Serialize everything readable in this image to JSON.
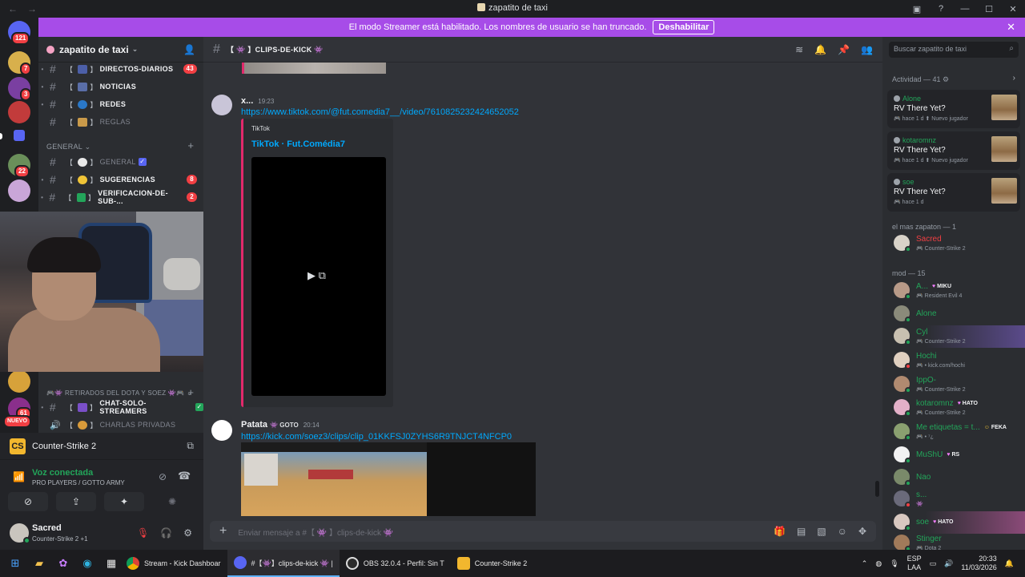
{
  "window": {
    "title": "zapatito de taxi"
  },
  "banner": {
    "text": "El modo Streamer está habilitado. Los nombres de usuario se han truncado.",
    "button": "Deshabilitar"
  },
  "rail": {
    "badge_top": "121",
    "badge_1": "7",
    "badge_2": "3",
    "badge_3": "22",
    "badge_4": "61",
    "new_label": "NUEVO"
  },
  "guild": {
    "name": "zapatito de taxi"
  },
  "channels": [
    {
      "name": "DIRECTOS-DIARIOS",
      "count": "43"
    },
    {
      "name": "NOTICIAS"
    },
    {
      "name": "REDES"
    },
    {
      "name": "REGLAS"
    }
  ],
  "category_general": "GENERAL",
  "general_channels": [
    {
      "name": "GENERAL"
    },
    {
      "name": "SUGERENCIAS",
      "count": "8"
    },
    {
      "name": "VERIFICACION-DE-SUB-...",
      "count": "2"
    }
  ],
  "category_retirados": "RETIRADOS DEL DOTA Y SOEZ",
  "lower_channels": [
    {
      "name": "CHAT-SOLO-STREAMERS"
    },
    {
      "name": "CHARLAS PRIVADAS"
    }
  ],
  "game_activity": {
    "name": "Counter-Strike 2"
  },
  "voice": {
    "status": "Voz conectada",
    "channel": "PRO PLAYERS / GOTTO ARMY"
  },
  "user": {
    "name": "Sacred",
    "activity": "Counter-Strike 2 +1"
  },
  "chat": {
    "channel_name": "CLIPS-DE-KICK",
    "messages": [
      {
        "author": "x...",
        "time": "19:23",
        "link": "https://www.tiktok.com/@fut.comedia7__/video/7610825232424652052",
        "embed_provider": "TikTok",
        "embed_title": "TikTok · Fut.Comédia7"
      },
      {
        "author": "Patata",
        "tag": "GOTO",
        "time": "20:14",
        "link": "https://kick.com/soez3/clips/clip_01KKFSJ0ZYHS6R9TNJCT4NFCP0"
      }
    ],
    "composer_placeholder": "Enviar mensaje a #【 👾 】clips-de-kick 👾"
  },
  "right": {
    "search_placeholder": "Buscar zapatito de taxi",
    "activity_header": "Actividad — 41",
    "activities": [
      {
        "user": "Alone",
        "game": "RV There Yet?",
        "meta": "🎮 hace 1 d  ⬆ Nuevo jugador"
      },
      {
        "user": "kotaromnz",
        "game": "RV There Yet?",
        "meta": "🎮 hace 1 d  ⬆ Nuevo jugador"
      },
      {
        "user": "soe",
        "game": "RV There Yet?",
        "meta": "🎮 hace 1 d"
      }
    ],
    "group1_header": "el mas zapaton — 1",
    "group1": [
      {
        "name": "Sacred",
        "sub": "🎮 Counter-Strike 2"
      }
    ],
    "group2_header": "mod — 15",
    "group2": [
      {
        "name": "A...",
        "tag": "MIKU",
        "sub": "🎮 Resident Evil 4"
      },
      {
        "name": "Alone",
        "sub": ""
      },
      {
        "name": "Cyl",
        "sub": "🎮 Counter-Strike 2"
      },
      {
        "name": "Hochi",
        "sub": "🎮 • kick.com/hochi"
      },
      {
        "name": "IppO-",
        "sub": "🎮 Counter-Strike 2"
      },
      {
        "name": "kotaromnz",
        "tag": "HATO",
        "sub": "🎮 Counter-Strike 2"
      },
      {
        "name": "Me etiquetas = t...",
        "tag": "FEKA",
        "sub": "🎮 • ⁷¿"
      },
      {
        "name": "MuShU",
        "tag": "RS",
        "sub": ""
      },
      {
        "name": "Nao",
        "sub": ""
      },
      {
        "name": "s...",
        "sub": "👾"
      },
      {
        "name": "soe",
        "tag": "HATO",
        "sub": ""
      },
      {
        "name": "Stinger",
        "sub": "🎮 Dota 2"
      }
    ]
  },
  "taskbar": {
    "apps": [
      {
        "label": "Stream - Kick Dashboar"
      },
      {
        "label": "#【👾】clips-de-kick 👾 |"
      },
      {
        "label": "OBS 32.0.4 - Perfil: Sin T"
      },
      {
        "label": "Counter-Strike 2"
      }
    ],
    "lang_top": "ESP",
    "lang_bottom": "LAA",
    "time": "20:33",
    "date": "11/03/2026"
  }
}
